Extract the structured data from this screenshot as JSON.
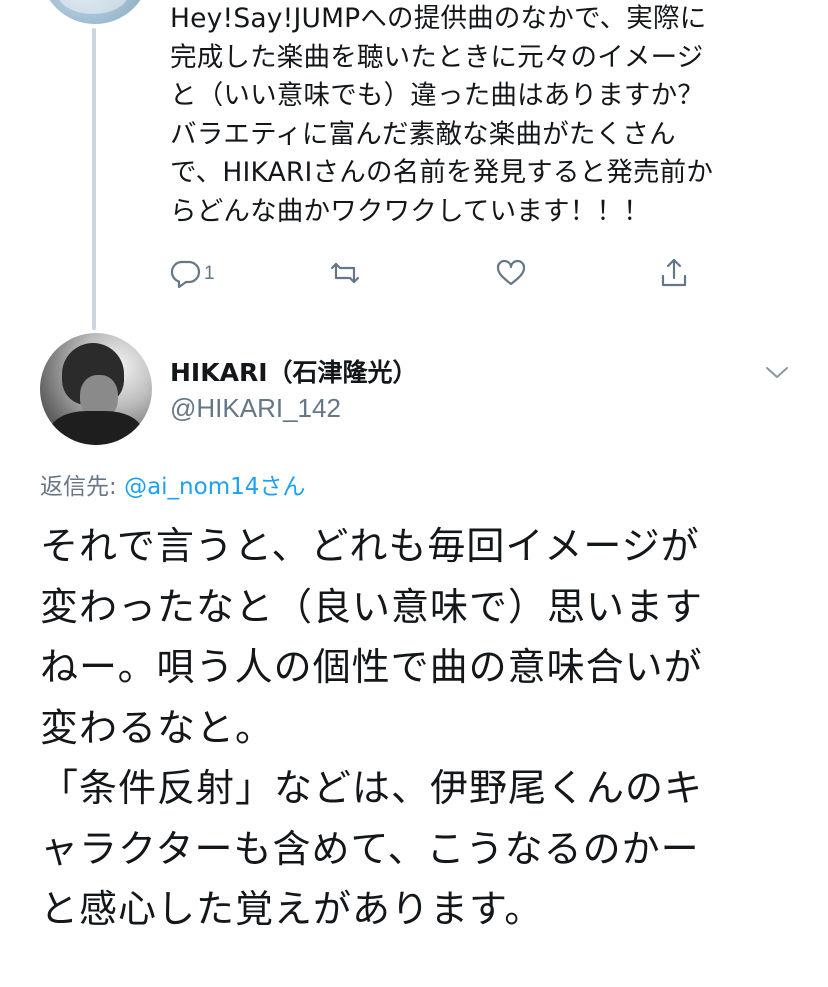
{
  "parent_tweet": {
    "text": "Hey!Say!JUMPへの提供曲のなかで、実際に\n完成した楽曲を聴いたときに元々のイメージ\nと（いい意味でも）違った曲はありますか？\nバラエティに富んだ素敵な楽曲がたくさん\nで、HIKARIさんの名前を発見すると発売前か\nらどんな曲かワクワクしています！！！",
    "reply_count": "1"
  },
  "tweet": {
    "display_name": "HIKARI（石津隆光）",
    "handle": "@HIKARI_142",
    "replying_to_label": "返信先: ",
    "replying_to_mention": "@ai_nom14さん",
    "text": "それで言うと、どれも毎回イメージが\n変わったなと（良い意味で）思います\nねー。唄う人の個性で曲の意味合いが\n変わるなと。\n「条件反射」などは、伊野尾くんのキ\nャラクターも含めて、こうなるのかー\nと感心した覚えがあります。"
  },
  "icons": {
    "reply": "reply-icon",
    "retweet": "retweet-icon",
    "like": "heart-icon",
    "share": "share-icon",
    "menu": "chevron-down-icon"
  },
  "colors": {
    "text": "#14171a",
    "secondary": "#657786",
    "link": "#1da1f2",
    "thread_line": "#ccd6dd"
  }
}
